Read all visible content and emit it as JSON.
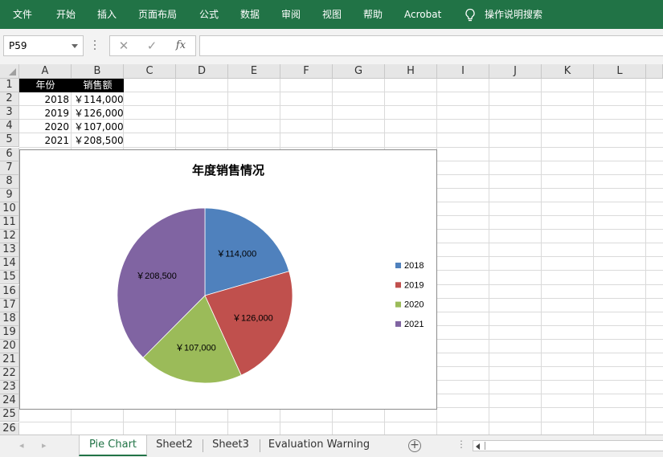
{
  "ribbon": {
    "tabs": [
      "文件",
      "开始",
      "插入",
      "页面布局",
      "公式",
      "数据",
      "审阅",
      "视图",
      "帮助",
      "Acrobat"
    ],
    "tell_me": "操作说明搜索"
  },
  "formula_bar": {
    "name_box": "P59",
    "cancel": "✕",
    "enter": "✓",
    "fx": "fx",
    "value": ""
  },
  "columns": [
    "A",
    "B",
    "C",
    "D",
    "E",
    "F",
    "G",
    "H",
    "I",
    "J",
    "K",
    "L"
  ],
  "rows": [
    "1",
    "2",
    "3",
    "4",
    "5",
    "6",
    "7",
    "8",
    "9",
    "10",
    "11",
    "12",
    "13",
    "14",
    "15",
    "16",
    "17",
    "18",
    "19",
    "20",
    "21",
    "22",
    "23",
    "24",
    "25",
    "26"
  ],
  "cells": {
    "A1": "年份",
    "B1": "销售额",
    "A2": "2018",
    "B2": "￥114,000",
    "A3": "2019",
    "B3": "￥126,000",
    "A4": "2020",
    "B4": "￥107,000",
    "A5": "2021",
    "B5": "￥208,500"
  },
  "chart_data": {
    "type": "pie",
    "title": "年度销售情况",
    "categories": [
      "2018",
      "2019",
      "2020",
      "2021"
    ],
    "values": [
      114000,
      126000,
      107000,
      208500
    ],
    "data_labels": [
      "￥114,000",
      "￥126,000",
      "￥107,000",
      "￥208,500"
    ],
    "colors": [
      "#4f81bd",
      "#c0504d",
      "#9bbb59",
      "#8064a2"
    ],
    "legend": "right",
    "start_angle": "12 o'clock, clockwise"
  },
  "sheets": {
    "tabs": [
      "Pie Chart",
      "Sheet2",
      "Sheet3",
      "Evaluation Warning"
    ],
    "active": "Pie Chart",
    "add": "+"
  }
}
